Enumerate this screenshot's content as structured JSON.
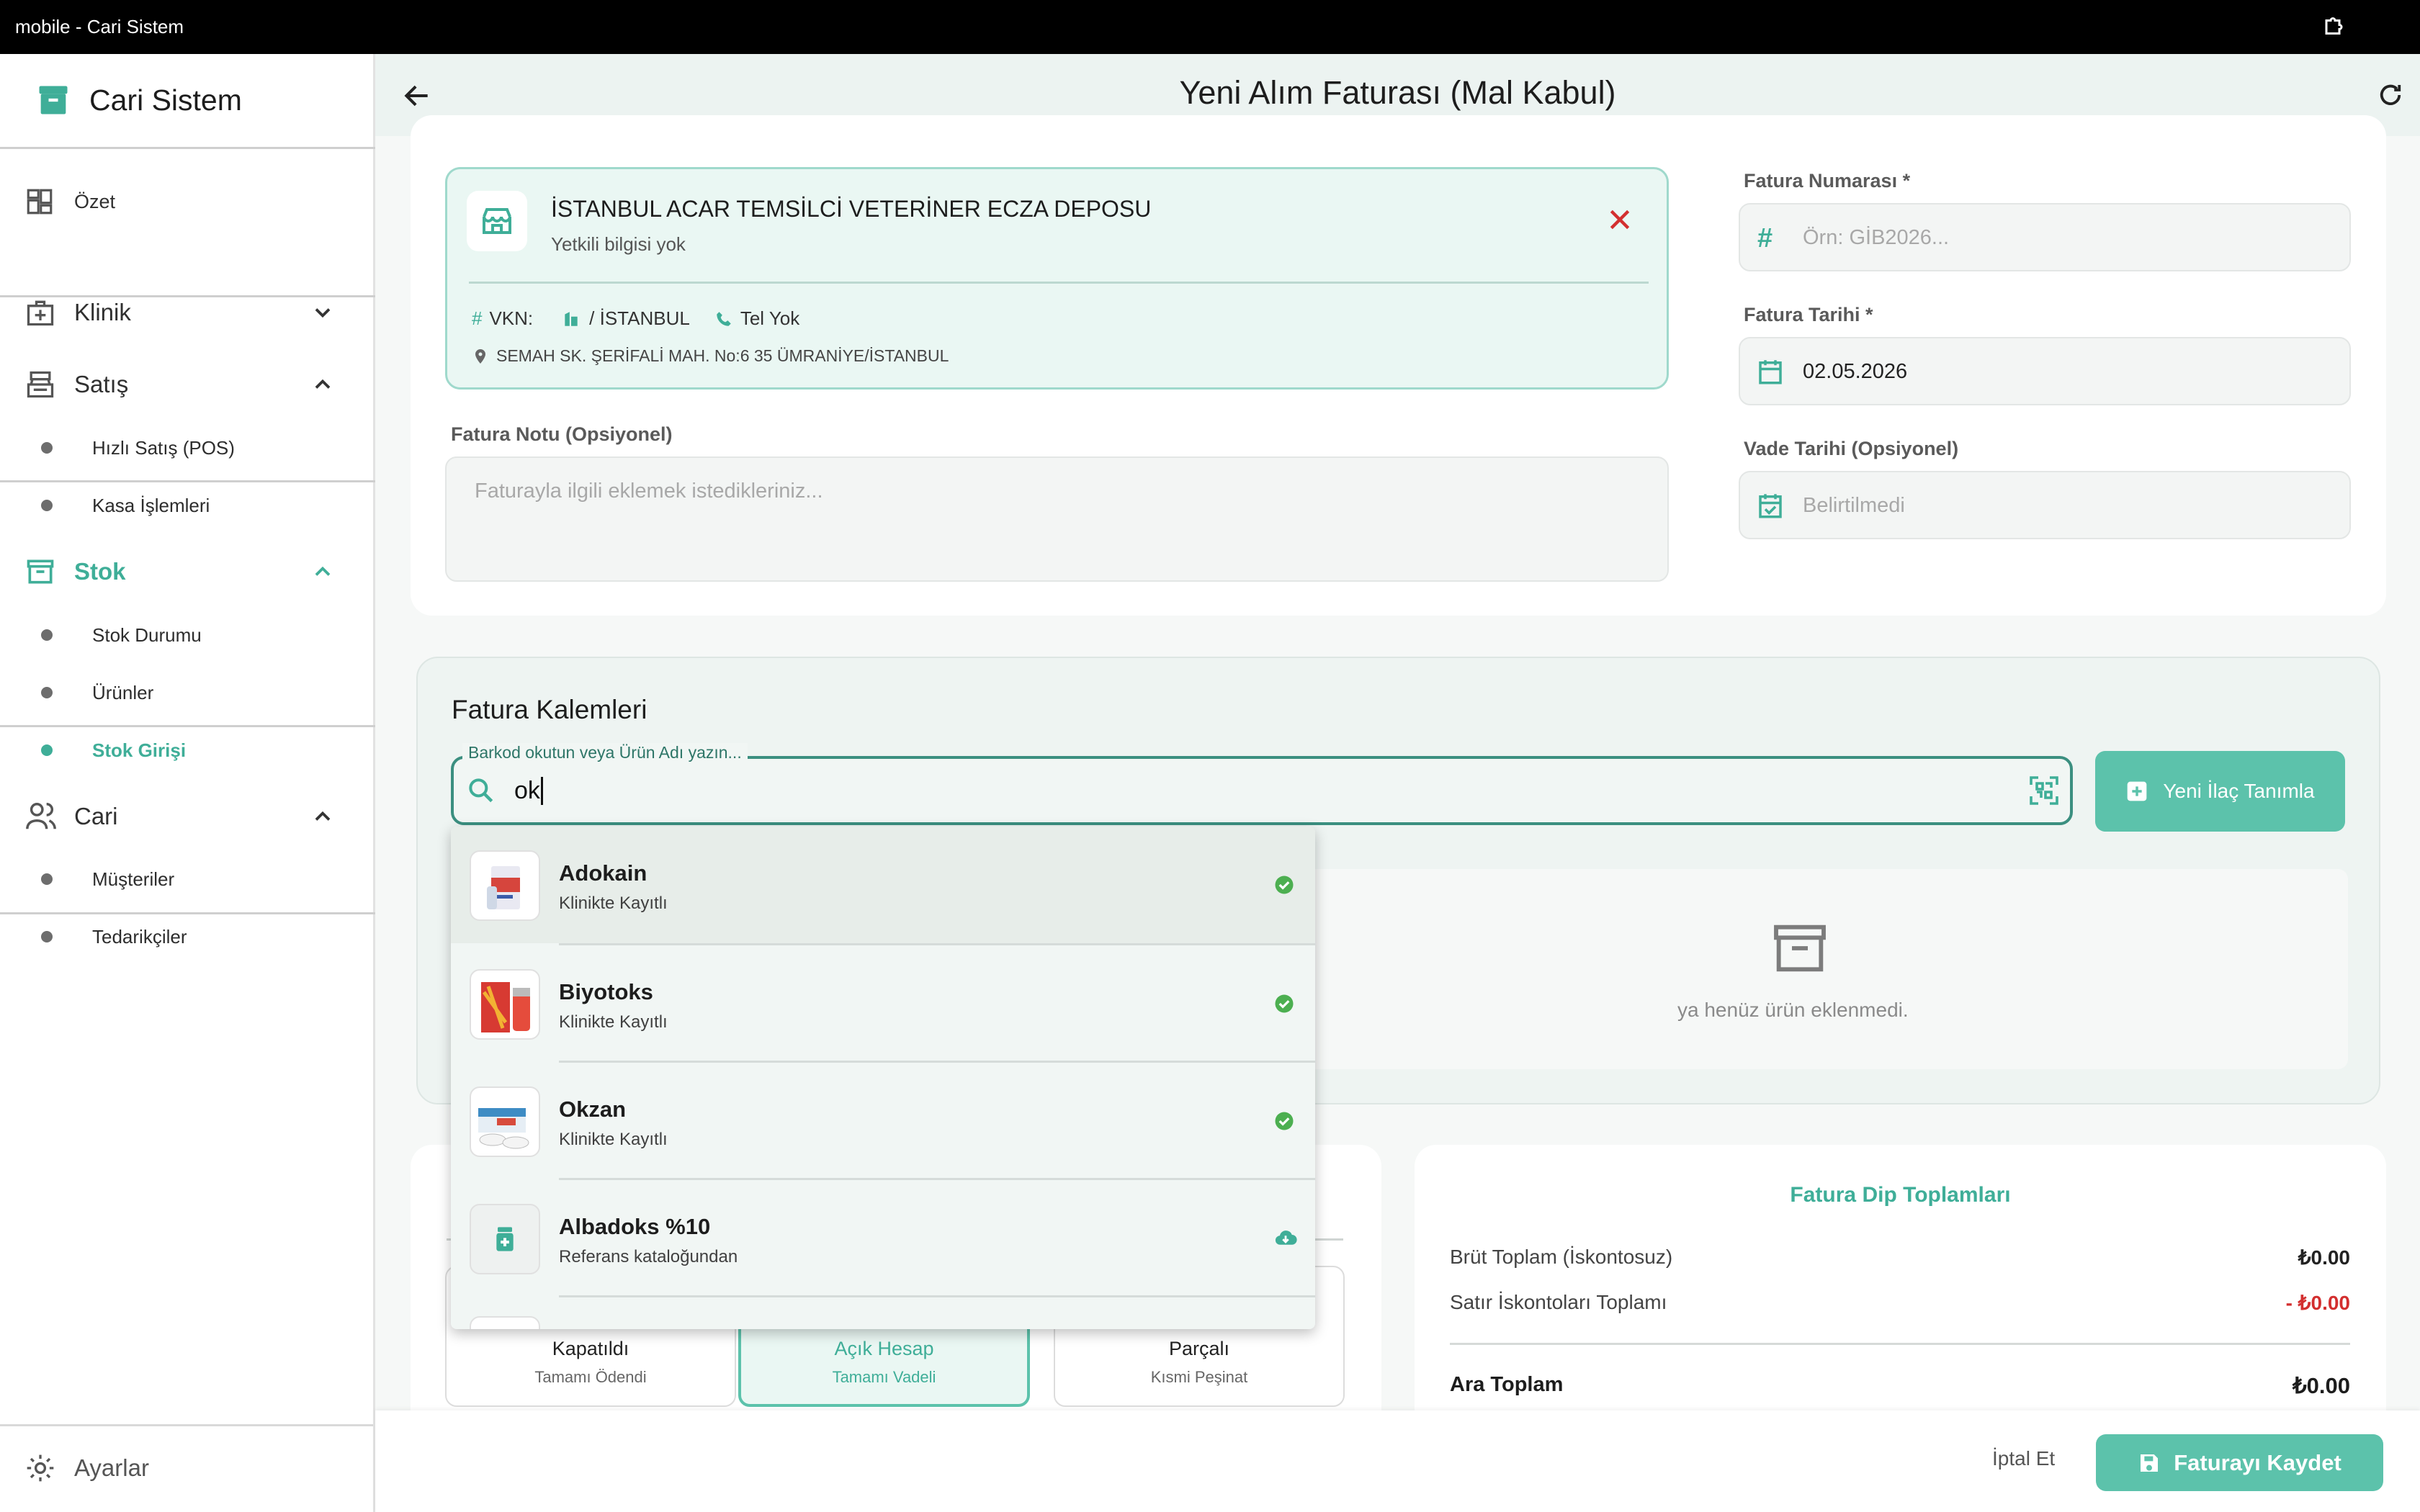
{
  "window": {
    "title": "mobile - Cari Sistem"
  },
  "sidebar": {
    "brand": "Cari Sistem",
    "items": [
      {
        "label": "Özet",
        "icon": "dashboard-icon"
      },
      {
        "label": "Klinik",
        "icon": "medical-bag-icon",
        "expanded": false
      },
      {
        "label": "Satış",
        "icon": "cash-register-icon",
        "expanded": true,
        "children": [
          {
            "label": "Hızlı Satış (POS)"
          },
          {
            "label": "Kasa İşlemleri"
          }
        ]
      },
      {
        "label": "Stok",
        "icon": "archive-icon",
        "expanded": true,
        "active": true,
        "children": [
          {
            "label": "Stok Durumu"
          },
          {
            "label": "Ürünler"
          },
          {
            "label": "Stok Girişi",
            "active": true
          }
        ]
      },
      {
        "label": "Cari",
        "icon": "people-icon",
        "expanded": true,
        "children": [
          {
            "label": "Müşteriler"
          },
          {
            "label": "Tedarikçiler"
          }
        ]
      }
    ],
    "settings": "Ayarlar"
  },
  "appbar": {
    "title": "Yeni Alım Faturası (Mal Kabul)"
  },
  "supplier": {
    "name": "İSTANBUL ACAR TEMSİLCİ VETERİNER ECZA DEPOSU",
    "contact": "Yetkili bilgisi yok",
    "vkn_label": "VKN:",
    "city": "/ İSTANBUL",
    "phone": "Tel Yok",
    "address": "SEMAH SK. ŞERİFALİ MAH. No:6 35 ÜMRANİYE/İSTANBUL"
  },
  "note": {
    "label": "Fatura Notu (Opsiyonel)",
    "placeholder": "Faturayla ilgili eklemek istedikleriniz..."
  },
  "invoice": {
    "number_label": "Fatura Numarası *",
    "number_placeholder": "Örn: GİB2026...",
    "date_label": "Fatura Tarihi *",
    "date_value": "02.05.2026",
    "due_label": "Vade Tarihi (Opsiyonel)",
    "due_placeholder": "Belirtilmedi"
  },
  "items_section": {
    "title": "Fatura Kalemleri",
    "search_label": "Barkod okutun veya Ürün Adı yazın...",
    "search_value": "ok",
    "new_button": "Yeni İlaç Tanımla",
    "empty_text": "ya henüz ürün eklenmedi."
  },
  "suggestions": [
    {
      "name": "Adokain",
      "sub": "Klinikte Kayıtlı",
      "status": "check-circle-icon",
      "highlight": true
    },
    {
      "name": "Biyotoks",
      "sub": "Klinikte Kayıtlı",
      "status": "check-circle-icon"
    },
    {
      "name": "Okzan",
      "sub": "Klinikte Kayıtlı",
      "status": "check-circle-icon"
    },
    {
      "name": "Albadoks %10",
      "sub": "Referans kataloğundan",
      "status": "cloud-download-icon"
    }
  ],
  "payment": {
    "options": [
      {
        "title": "Kapatıldı",
        "sub": "Tamamı Ödendi"
      },
      {
        "title": "Açık Hesap",
        "sub": "Tamamı Vadeli",
        "selected": true
      },
      {
        "title": "Parçalı",
        "sub": "Kısmi Peşinat"
      }
    ]
  },
  "totals": {
    "title": "Fatura Dip Toplamları",
    "gross_label": "Brüt Toplam (İskontosuz)",
    "gross_value": "₺0.00",
    "discount_label": "Satır İskontoları Toplamı",
    "discount_value": "- ₺0.00",
    "subtotal_label": "Ara Toplam",
    "subtotal_value": "₺0.00"
  },
  "footer": {
    "cancel": "İptal Et",
    "save": "Faturayı Kaydet"
  },
  "colors": {
    "accent": "#3fae98",
    "button": "#5cc2ab",
    "danger": "#d32f2f"
  }
}
